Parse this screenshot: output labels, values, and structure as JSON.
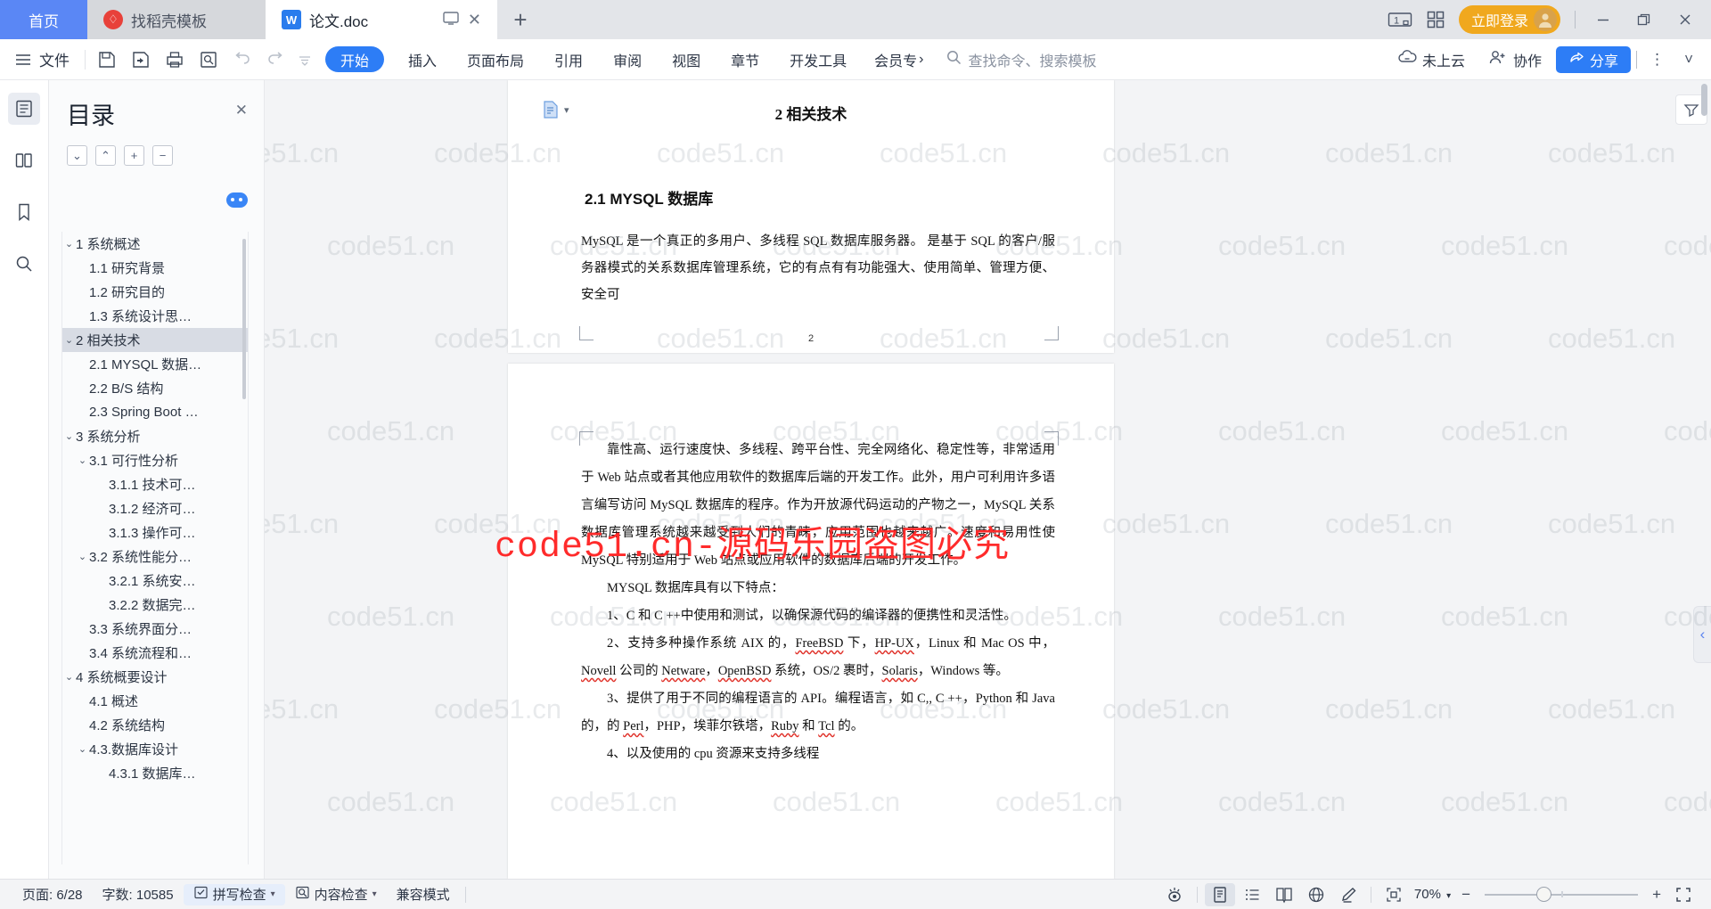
{
  "titlebar": {
    "home_tab": "首页",
    "tabs": [
      {
        "label": "找稻壳模板",
        "icon": "wps-template-icon",
        "active": false
      },
      {
        "label": "论文.doc",
        "icon": "writer-doc-icon",
        "active": true
      }
    ],
    "new_tab": "+",
    "screen_count": "1",
    "login_button": "立即登录",
    "icons": {
      "multi_window": "multi-window-icon",
      "app_grid": "app-grid-icon",
      "minimize": "minimize-icon",
      "maximize": "restore-icon",
      "close": "close-icon"
    }
  },
  "ribbon": {
    "menu_icon": "hamburger-icon",
    "file_label": "文件",
    "quick_icons": [
      "save-icon",
      "save-as-icon",
      "print-icon",
      "print-preview-icon",
      "undo-icon",
      "redo-icon",
      "customize-icon"
    ],
    "start_tab": "开始",
    "tabs": [
      "插入",
      "页面布局",
      "引用",
      "审阅",
      "视图",
      "章节",
      "开发工具"
    ],
    "member_label": "会员专",
    "search_placeholder": "查找命令、搜索模板",
    "cloud_status": "未上云",
    "collab_label": "协作",
    "share_label": "分享",
    "more_icon": "more-vertical-icon",
    "collapse_icon": "chevron-down-icon"
  },
  "leftrail": {
    "items": [
      {
        "name": "outline-icon",
        "glyph": "▤",
        "active": true
      },
      {
        "name": "thumbnail-icon",
        "glyph": "◫",
        "active": false
      },
      {
        "name": "bookmark-icon",
        "glyph": "🔖",
        "active": false
      },
      {
        "name": "search-icon",
        "glyph": "⌕",
        "active": false
      }
    ]
  },
  "toc": {
    "title": "目录",
    "close_icon": "close-icon",
    "tools": [
      {
        "name": "expand-down-button",
        "glyph": "⌄"
      },
      {
        "name": "collapse-up-button",
        "glyph": "⌃"
      },
      {
        "name": "expand-all-button",
        "glyph": "+"
      },
      {
        "name": "collapse-all-button",
        "glyph": "−"
      }
    ],
    "toggle_name": "toc-settings-toggle",
    "items": [
      {
        "label": "1 系统概述",
        "level": 1,
        "caret": "⌄",
        "selected": false
      },
      {
        "label": "1.1  研究背景",
        "level": 2,
        "caret": "",
        "selected": false
      },
      {
        "label": "1.2 研究目的",
        "level": 2,
        "caret": "",
        "selected": false
      },
      {
        "label": "1.3 系统设计思…",
        "level": 2,
        "caret": "",
        "selected": false
      },
      {
        "label": "2 相关技术",
        "level": 1,
        "caret": "⌄",
        "selected": true
      },
      {
        "label": "2.1 MYSQL 数据…",
        "level": 2,
        "caret": "",
        "selected": false
      },
      {
        "label": "2.2 B/S 结构",
        "level": 2,
        "caret": "",
        "selected": false
      },
      {
        "label": "2.3 Spring Boot …",
        "level": 2,
        "caret": "",
        "selected": false
      },
      {
        "label": "3 系统分析",
        "level": 1,
        "caret": "⌄",
        "selected": false
      },
      {
        "label": "3.1 可行性分析",
        "level": 2,
        "caret": "⌄",
        "selected": false
      },
      {
        "label": "3.1.1 技术可…",
        "level": 3,
        "caret": "",
        "selected": false
      },
      {
        "label": "3.1.2 经济可…",
        "level": 3,
        "caret": "",
        "selected": false
      },
      {
        "label": "3.1.3 操作可…",
        "level": 3,
        "caret": "",
        "selected": false
      },
      {
        "label": "3.2 系统性能分…",
        "level": 2,
        "caret": "⌄",
        "selected": false
      },
      {
        "label": "3.2.1  系统安…",
        "level": 3,
        "caret": "",
        "selected": false
      },
      {
        "label": "3.2.2  数据完…",
        "level": 3,
        "caret": "",
        "selected": false
      },
      {
        "label": "3.3 系统界面分…",
        "level": 2,
        "caret": "",
        "selected": false
      },
      {
        "label": "3.4 系统流程和…",
        "level": 2,
        "caret": "",
        "selected": false
      },
      {
        "label": "4 系统概要设计",
        "level": 1,
        "caret": "⌄",
        "selected": false
      },
      {
        "label": "4.1 概述",
        "level": 2,
        "caret": "",
        "selected": false
      },
      {
        "label": "4.2 系统结构",
        "level": 2,
        "caret": "",
        "selected": false
      },
      {
        "label": "4.3.数据库设计",
        "level": 2,
        "caret": "⌄",
        "selected": false
      },
      {
        "label": "4.3.1 数据库…",
        "level": 3,
        "caret": "",
        "selected": false
      }
    ]
  },
  "document": {
    "page1": {
      "header_title": "2 相关技术",
      "heading": "2.1 MYSQL 数据库",
      "paragraph": "MySQL 是一个真正的多用户、多线程 SQL 数据库服务器。 是基于 SQL 的客户/服务器模式的关系数据库管理系统，它的有点有有功能强大、使用简单、管理方便、安全可",
      "page_number": "2"
    },
    "page2": {
      "para1": "靠性高、运行速度快、多线程、跨平台性、完全网络化、稳定性等，非常适用于 Web 站点或者其他应用软件的数据库后端的开发工作。此外，用户可利用许多语言编写访问 MySQL 数据库的程序。作为开放源代码运动的产物之一，MySQL 关系数据库管理系统越来越受到人们的青睐，应用范围也越来越广。速度和易用性使 MySQL 特别适用于 Web 站点或应用软件的数据库后端的开发工作。",
      "para2": "MYSQL 数据库具有以下特点：",
      "item1": "1、C 和 C ++中使用和测试，以确保源代码的编译器的便携性和灵活性。",
      "item2_a": "2、支持多种操作系统 AIX 的，",
      "item2_b": "FreeBSD",
      "item2_c": " 下，",
      "item2_d": "HP-UX",
      "item2_e": "，Linux 和 Mac OS 中，",
      "item2_f": "Novell",
      "item2_g": " 公司的 ",
      "item2_h": "Netware",
      "item2_i": "，",
      "item2_j": "OpenBSD",
      "item2_k": " 系统，OS/2 裹时，",
      "item2_l": "Solaris",
      "item2_m": "，Windows 等。",
      "item3_a": "3、提供了用于不同的编程语言的 API。编程语言，如 C,, C ++，Python 和 Java 的，的 ",
      "item3_b": "Perl",
      "item3_c": "，PHP，埃菲尔铁塔，",
      "item3_d": "Ruby",
      "item3_e": " 和 ",
      "item3_f": "Tcl",
      "item3_g": " 的。",
      "item4": "4、以及使用的 cpu 资源来支持多线程"
    },
    "watermark_text": "code51.cn",
    "overlay_text": "code51.cn-源码乐园盗图必究",
    "overlay_color": "#ff2b2b"
  },
  "rightrail": {
    "filter_icon": "filter-panel-icon",
    "handle_icon": "chevron-left-icon"
  },
  "statusbar": {
    "page_label": "页面: 6/28",
    "word_count_label": "字数: 10585",
    "spellcheck_label": "拼写检查",
    "contentcheck_label": "内容检查",
    "compat_label": "兼容模式",
    "view_icons": [
      {
        "name": "eye-reading-icon",
        "glyph": "◉",
        "active": false
      },
      {
        "name": "page-layout-view-icon",
        "glyph": "▤",
        "active": true
      },
      {
        "name": "outline-view-icon",
        "glyph": "☰",
        "active": false
      },
      {
        "name": "reading-view-icon",
        "glyph": "📖",
        "active": false
      },
      {
        "name": "web-view-icon",
        "glyph": "⊕",
        "active": false
      },
      {
        "name": "highlight-pen-icon",
        "glyph": "✎",
        "active": false
      }
    ],
    "fit-page-icon": "fit-page-icon",
    "zoom_value": "70%",
    "zoom_out": "−",
    "zoom_in": "+",
    "fullscreen_icon": "fullscreen-icon"
  }
}
